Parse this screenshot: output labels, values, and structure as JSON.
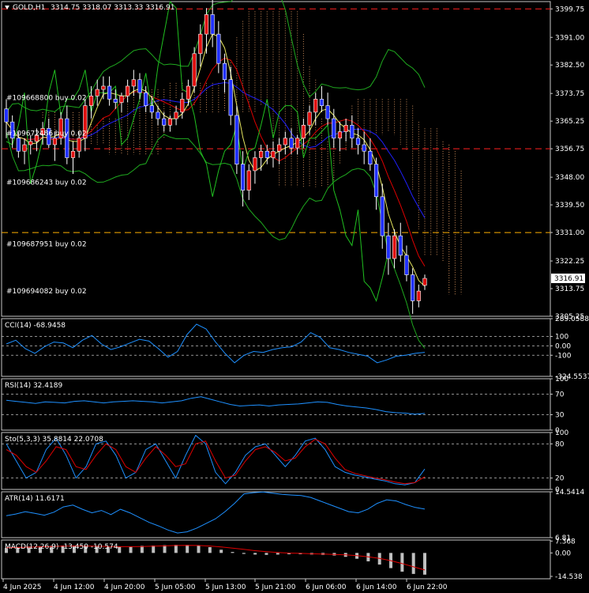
{
  "header": {
    "symbol_tf": "GOLD,H1",
    "ohlc": "3314.75 3318.07 3313.33 3316.91",
    "current_price": "3316.91"
  },
  "colors": {
    "bull_candle": "#e01010",
    "bear_candle": "#2030ff",
    "doji": "#ffffff",
    "bb_mid": "#2020ff",
    "bb_outer": "#1faa1f",
    "ma_red": "#dd0000",
    "ma_yellow": "#e8e860",
    "chikou": "#20c020",
    "cloud": "#ffb070",
    "order_line": "#ff2020",
    "buy_line": "#ffb000",
    "indicator_line": "#1e90ff",
    "signal_line": "#e00000",
    "macd_hist": "#c0c0c0",
    "grid": "#c0c0c0"
  },
  "orders": [
    {
      "label": "#109668800 buy 0.02",
      "price": 3372.5
    },
    {
      "label": "#109672486 buy 0.02",
      "price": 3361.5
    },
    {
      "label": "#109686243 buy 0.02",
      "price": 3346.5
    },
    {
      "label": "#109687951 buy 0.02",
      "price": 3327.5
    },
    {
      "label": "#109694082 buy 0.02",
      "price": 3313.0
    }
  ],
  "chart_data": [
    {
      "id": "price",
      "type": "candlestick",
      "title": "GOLD,H1",
      "ylim": [
        3305.25,
        3402.0
      ],
      "y_ticks": [
        "3399.75",
        "3391.00",
        "3382.50",
        "3373.75",
        "3365.25",
        "3356.75",
        "3348.00",
        "3339.50",
        "3331.00",
        "3322.25",
        "3313.75",
        "3305.25"
      ],
      "horizontal_lines": [
        {
          "price": 3399.75,
          "style": "dashed"
        },
        {
          "price": 3356.75,
          "style": "dashed"
        },
        {
          "price": 3331.0,
          "style": "dashed"
        }
      ],
      "candles": [
        [
          3369,
          3372,
          3360,
          3365
        ],
        [
          3365,
          3367,
          3357,
          3360
        ],
        [
          3360,
          3362,
          3354,
          3356
        ],
        [
          3356,
          3360,
          3352,
          3358
        ],
        [
          3358,
          3361,
          3355,
          3359
        ],
        [
          3359,
          3363,
          3356,
          3361
        ],
        [
          3361,
          3365,
          3358,
          3363
        ],
        [
          3363,
          3366,
          3357,
          3358
        ],
        [
          3358,
          3362,
          3353,
          3360
        ],
        [
          3360,
          3368,
          3358,
          3366
        ],
        [
          3366,
          3370,
          3352,
          3354
        ],
        [
          3354,
          3359,
          3349,
          3356
        ],
        [
          3356,
          3362,
          3354,
          3360
        ],
        [
          3360,
          3372,
          3356,
          3370
        ],
        [
          3370,
          3376,
          3366,
          3373
        ],
        [
          3373,
          3378,
          3370,
          3375
        ],
        [
          3375,
          3379,
          3372,
          3376
        ],
        [
          3376,
          3379,
          3370,
          3372
        ],
        [
          3372,
          3375,
          3369,
          3371
        ],
        [
          3371,
          3374,
          3368,
          3373
        ],
        [
          3373,
          3378,
          3371,
          3376
        ],
        [
          3376,
          3381,
          3373,
          3378
        ],
        [
          3378,
          3380,
          3372,
          3374
        ],
        [
          3374,
          3376,
          3368,
          3370
        ],
        [
          3370,
          3373,
          3366,
          3368
        ],
        [
          3368,
          3370,
          3364,
          3366
        ],
        [
          3366,
          3368,
          3362,
          3364
        ],
        [
          3364,
          3367,
          3362,
          3366
        ],
        [
          3366,
          3370,
          3364,
          3368
        ],
        [
          3368,
          3374,
          3366,
          3372
        ],
        [
          3372,
          3378,
          3370,
          3376
        ],
        [
          3376,
          3388,
          3374,
          3386
        ],
        [
          3386,
          3395,
          3382,
          3392
        ],
        [
          3392,
          3400,
          3386,
          3398
        ],
        [
          3398,
          3403,
          3388,
          3392
        ],
        [
          3392,
          3396,
          3380,
          3383
        ],
        [
          3383,
          3386,
          3374,
          3378
        ],
        [
          3378,
          3382,
          3364,
          3367
        ],
        [
          3367,
          3370,
          3349,
          3352
        ],
        [
          3352,
          3356,
          3339,
          3344
        ],
        [
          3344,
          3352,
          3341,
          3350
        ],
        [
          3350,
          3356,
          3346,
          3354
        ],
        [
          3354,
          3358,
          3350,
          3356
        ],
        [
          3356,
          3358,
          3352,
          3354
        ],
        [
          3354,
          3359,
          3351,
          3356
        ],
        [
          3356,
          3360,
          3352,
          3358
        ],
        [
          3358,
          3362,
          3355,
          3360
        ],
        [
          3360,
          3363,
          3355,
          3357
        ],
        [
          3357,
          3361,
          3355,
          3360
        ],
        [
          3360,
          3366,
          3357,
          3364
        ],
        [
          3364,
          3370,
          3361,
          3368
        ],
        [
          3368,
          3374,
          3364,
          3372
        ],
        [
          3372,
          3376,
          3368,
          3370
        ],
        [
          3370,
          3374,
          3364,
          3366
        ],
        [
          3366,
          3369,
          3357,
          3360
        ],
        [
          3360,
          3365,
          3356,
          3362
        ],
        [
          3362,
          3366,
          3359,
          3364
        ],
        [
          3364,
          3367,
          3357,
          3360
        ],
        [
          3360,
          3363,
          3355,
          3358
        ],
        [
          3358,
          3362,
          3352,
          3356
        ],
        [
          3356,
          3360,
          3350,
          3352
        ],
        [
          3352,
          3354,
          3338,
          3342
        ],
        [
          3342,
          3346,
          3326,
          3330
        ],
        [
          3330,
          3334,
          3318,
          3323
        ],
        [
          3323,
          3332,
          3320,
          3330
        ],
        [
          3330,
          3334,
          3322,
          3324
        ],
        [
          3324,
          3327,
          3316,
          3318
        ],
        [
          3318,
          3320,
          3306,
          3310
        ],
        [
          3310,
          3315,
          3308,
          3313
        ],
        [
          3314.75,
          3318.07,
          3313.33,
          3316.91
        ]
      ]
    },
    {
      "id": "cci",
      "type": "line",
      "title": "CCI(14) -68.9458",
      "ylim": [
        -324.5537,
        289.0588
      ],
      "y_ticks": [
        "289.0588",
        "100",
        "0.00",
        "-100",
        "-324.5537"
      ],
      "levels": [
        100,
        0,
        -100
      ],
      "series": [
        {
          "name": "CCI(14)",
          "values": [
            20,
            60,
            -30,
            -80,
            -10,
            40,
            30,
            -20,
            60,
            110,
            20,
            -40,
            -10,
            30,
            70,
            50,
            -30,
            -120,
            -60,
            120,
            230,
            180,
            40,
            -80,
            -180,
            -100,
            -60,
            -70,
            -40,
            -20,
            -10,
            40,
            140,
            90,
            -20,
            -40,
            -70,
            -90,
            -110,
            -180,
            -150,
            -110,
            -100,
            -80,
            -68.9458
          ]
        }
      ]
    },
    {
      "id": "rsi",
      "type": "line",
      "title": "RSI(14) 32.4189",
      "ylim": [
        0,
        100
      ],
      "y_ticks": [
        "100",
        "70",
        "30",
        "0"
      ],
      "levels": [
        70,
        30
      ],
      "series": [
        {
          "name": "RSI(14)",
          "values": [
            58,
            56,
            54,
            52,
            55,
            54,
            53,
            56,
            57,
            55,
            53,
            55,
            56,
            57,
            56,
            55,
            53,
            55,
            57,
            62,
            65,
            60,
            55,
            50,
            47,
            48,
            49,
            47,
            49,
            50,
            51,
            53,
            55,
            54,
            50,
            47,
            45,
            43,
            40,
            36,
            34,
            33,
            31,
            32.4189
          ]
        }
      ]
    },
    {
      "id": "stoch",
      "type": "line",
      "title": "Sto(5,3,3) 35.8814 22.0708",
      "ylim": [
        0,
        100
      ],
      "y_ticks": [
        "100",
        "80",
        "20",
        "0"
      ],
      "levels": [
        80,
        20
      ],
      "series": [
        {
          "name": "%K",
          "values": [
            80,
            50,
            20,
            30,
            70,
            90,
            60,
            20,
            40,
            80,
            85,
            60,
            20,
            30,
            70,
            80,
            50,
            20,
            60,
            95,
            80,
            30,
            10,
            30,
            60,
            75,
            80,
            60,
            40,
            60,
            85,
            90,
            70,
            40,
            30,
            25,
            22,
            18,
            15,
            10,
            8,
            12,
            35.8814
          ]
        },
        {
          "name": "%D",
          "values": [
            70,
            60,
            40,
            30,
            50,
            75,
            70,
            40,
            35,
            60,
            80,
            70,
            40,
            30,
            55,
            75,
            60,
            40,
            45,
            80,
            85,
            50,
            20,
            25,
            50,
            70,
            75,
            65,
            50,
            55,
            75,
            88,
            80,
            55,
            35,
            28,
            24,
            20,
            17,
            13,
            10,
            12,
            22.0708
          ]
        }
      ]
    },
    {
      "id": "atr",
      "type": "line",
      "title": "ATR(14) 11.6171",
      "ylim": [
        6.81,
        14.5414
      ],
      "y_ticks": [
        "14.5414",
        "6.81"
      ],
      "series": [
        {
          "name": "ATR(14)",
          "values": [
            10.5,
            10.8,
            11.2,
            10.9,
            10.6,
            11.1,
            12.0,
            12.3,
            11.6,
            11.0,
            11.4,
            10.7,
            11.6,
            11.0,
            10.2,
            9.4,
            8.8,
            8.1,
            7.6,
            7.8,
            8.4,
            9.2,
            10.0,
            11.2,
            12.6,
            14.2,
            14.4,
            14.5,
            14.3,
            14.1,
            14.0,
            13.9,
            13.6,
            13.0,
            12.4,
            11.8,
            11.2,
            11.0,
            11.6,
            12.6,
            13.2,
            13.0,
            12.4,
            11.9,
            11.6171
          ]
        }
      ]
    },
    {
      "id": "macd",
      "type": "bar",
      "title": "MACD(12,26,9) -13.450 -10.574",
      "ylim": [
        -16.0,
        8.0
      ],
      "y_ticks": [
        "7.368",
        "0.00",
        "-14.538"
      ],
      "series": [
        {
          "name": "MACD",
          "values": [
            3,
            3.5,
            4,
            4.2,
            4.4,
            4.6,
            4.6,
            4.4,
            4.0,
            3.6,
            3.8,
            4.0,
            4.4,
            4.6,
            4.8,
            5.0,
            5.0,
            4.6,
            3.6,
            2.0,
            0.6,
            -0.6,
            -1.0,
            -1.2,
            -1.0,
            -0.8,
            -0.8,
            -1.0,
            -1.2,
            -1.6,
            -2.4,
            -3.6,
            -5.2,
            -7.2,
            -9.4,
            -11.6,
            -13.0,
            -13.45
          ]
        },
        {
          "name": "Signal",
          "values": [
            3.2,
            3.4,
            3.6,
            3.8,
            4.0,
            4.2,
            4.3,
            4.3,
            4.2,
            4.0,
            3.9,
            3.9,
            4.0,
            4.2,
            4.4,
            4.6,
            4.7,
            4.6,
            4.3,
            3.7,
            3.0,
            2.2,
            1.4,
            0.8,
            0.3,
            -0.1,
            -0.3,
            -0.5,
            -0.7,
            -0.9,
            -1.2,
            -1.7,
            -2.4,
            -3.4,
            -4.8,
            -6.6,
            -8.6,
            -10.574
          ]
        }
      ]
    }
  ],
  "x_axis": {
    "labels": [
      "4 Jun 2025",
      "4 Jun 12:00",
      "4 Jun 20:00",
      "5 Jun 05:00",
      "5 Jun 13:00",
      "5 Jun 21:00",
      "6 Jun 06:00",
      "6 Jun 14:00",
      "6 Jun 22:00"
    ]
  }
}
